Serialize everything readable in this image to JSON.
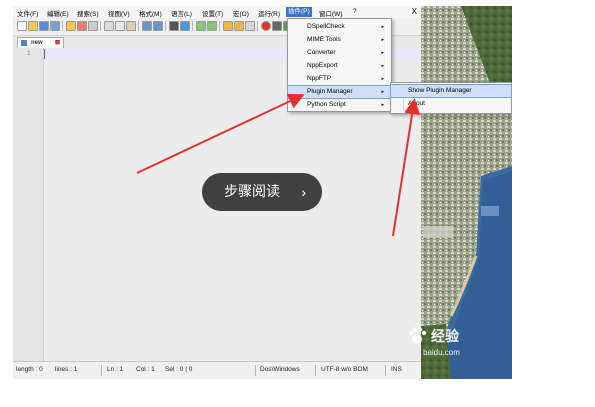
{
  "menubar": {
    "items": [
      "文件(F)",
      "编辑(E)",
      "搜索(S)",
      "视图(V)",
      "格式(M)",
      "语言(L)",
      "设置(T)",
      "宏(O)",
      "运行(R)",
      "插件(P)",
      "窗口(W)",
      "?"
    ],
    "close": "X"
  },
  "tab": {
    "label": "new",
    "close": "⊠"
  },
  "editor": {
    "line_number": "1"
  },
  "plugins_menu": {
    "items": [
      {
        "label": "DSpellCheck"
      },
      {
        "label": "MIME Tools"
      },
      {
        "label": "Converter"
      },
      {
        "label": "NppExport"
      },
      {
        "label": "NppFTP"
      },
      {
        "label": "Plugin Manager"
      },
      {
        "label": "Python Script"
      }
    ],
    "arrow": "▸"
  },
  "submenu": {
    "items": [
      {
        "label": "Show Plugin Manager"
      },
      {
        "label": "About"
      }
    ]
  },
  "statusbar": {
    "length": "length : 0",
    "lines": "lines : 1",
    "ln": "Ln : 1",
    "col": "Col : 1",
    "sel": "Sel : 0 | 0",
    "eol": "Dos\\Windows",
    "encoding": "UTF-8 w/o BOM",
    "mode": "INS"
  },
  "overlay": {
    "label": "步骤阅读",
    "chevron": "›"
  },
  "watermark": {
    "cn": "经验",
    "en": "baidu.com"
  },
  "colors": {
    "highlight": "#cde0f7",
    "arrow": "#e53030",
    "overlay": "#282828"
  },
  "icons": [
    "new-file-icon",
    "open-file-icon",
    "save-icon",
    "save-all-icon",
    "close-icon",
    "print-icon",
    "cut-icon",
    "copy-icon",
    "paste-icon",
    "undo-icon",
    "redo-icon",
    "find-icon",
    "replace-icon",
    "zoom-in-icon",
    "zoom-out-icon",
    "sync-icon",
    "wrap-icon",
    "macro-record-icon",
    "macro-play-icon"
  ]
}
